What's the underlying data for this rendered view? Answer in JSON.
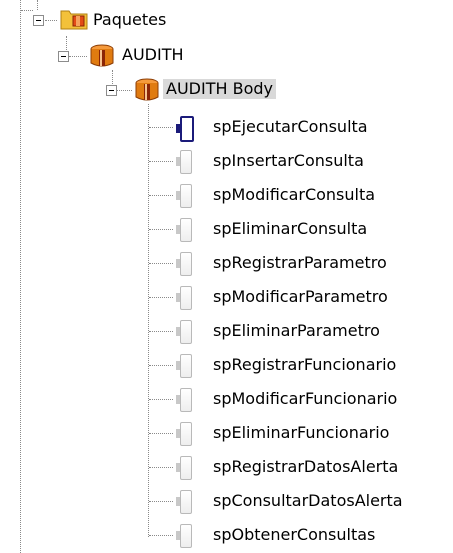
{
  "tree": {
    "packages_folder": {
      "label": "Paquetes",
      "icon": "packages-folder-icon",
      "expanded": true
    },
    "package": {
      "label": "AUDITH",
      "icon": "package-icon",
      "expanded": true
    },
    "package_body": {
      "label": "AUDITH Body",
      "icon": "package-body-icon",
      "expanded": true,
      "selected": true
    },
    "procedures": [
      {
        "label": "spEjecutarConsulta",
        "icon": "procedure-icon",
        "active": true
      },
      {
        "label": "spInsertarConsulta",
        "icon": "procedure-icon"
      },
      {
        "label": "spModificarConsulta",
        "icon": "procedure-icon"
      },
      {
        "label": "spEliminarConsulta",
        "icon": "procedure-icon"
      },
      {
        "label": "spRegistrarParametro",
        "icon": "procedure-icon"
      },
      {
        "label": "spModificarParametro",
        "icon": "procedure-icon"
      },
      {
        "label": "spEliminarParametro",
        "icon": "procedure-icon"
      },
      {
        "label": "spRegistrarFuncionario",
        "icon": "procedure-icon"
      },
      {
        "label": "spModificarFuncionario",
        "icon": "procedure-icon"
      },
      {
        "label": "spEliminarFuncionario",
        "icon": "procedure-icon"
      },
      {
        "label": "spRegistrarDatosAlerta",
        "icon": "procedure-icon"
      },
      {
        "label": "spConsultarDatosAlerta",
        "icon": "procedure-icon"
      },
      {
        "label": "spObtenerConsultas",
        "icon": "procedure-icon"
      }
    ]
  },
  "colors": {
    "selection_bg": "#d9d9d9",
    "active_icon": "#1b1b7a",
    "tree_lines": "#8a8a8a",
    "package_orange": "#e07b10"
  }
}
